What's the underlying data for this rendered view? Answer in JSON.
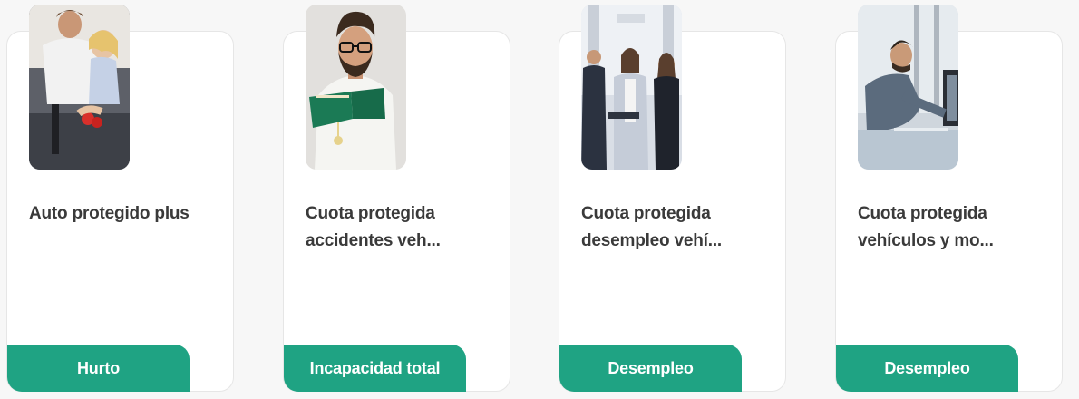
{
  "cards": [
    {
      "title_line1": "Auto protegido plus",
      "title_line2": "",
      "tag": "Hurto",
      "photo": "father-daughter-washing-fruit-photo"
    },
    {
      "title_line1": "Cuota protegida",
      "title_line2": "accidentes veh...",
      "tag": "Incapacidad total",
      "photo": "man-reading-book-photo"
    },
    {
      "title_line1": "Cuota protegida",
      "title_line2": "desempleo vehí...",
      "tag": "Desempleo",
      "photo": "business-team-photo"
    },
    {
      "title_line1": "Cuota protegida",
      "title_line2": "vehículos y mo...",
      "tag": "Desempleo",
      "photo": "man-at-computer-photo"
    }
  ],
  "colors": {
    "accent": "#1fa383",
    "title": "#3a3a3a",
    "card_bg": "#ffffff",
    "page_bg": "#f7f7f7"
  }
}
